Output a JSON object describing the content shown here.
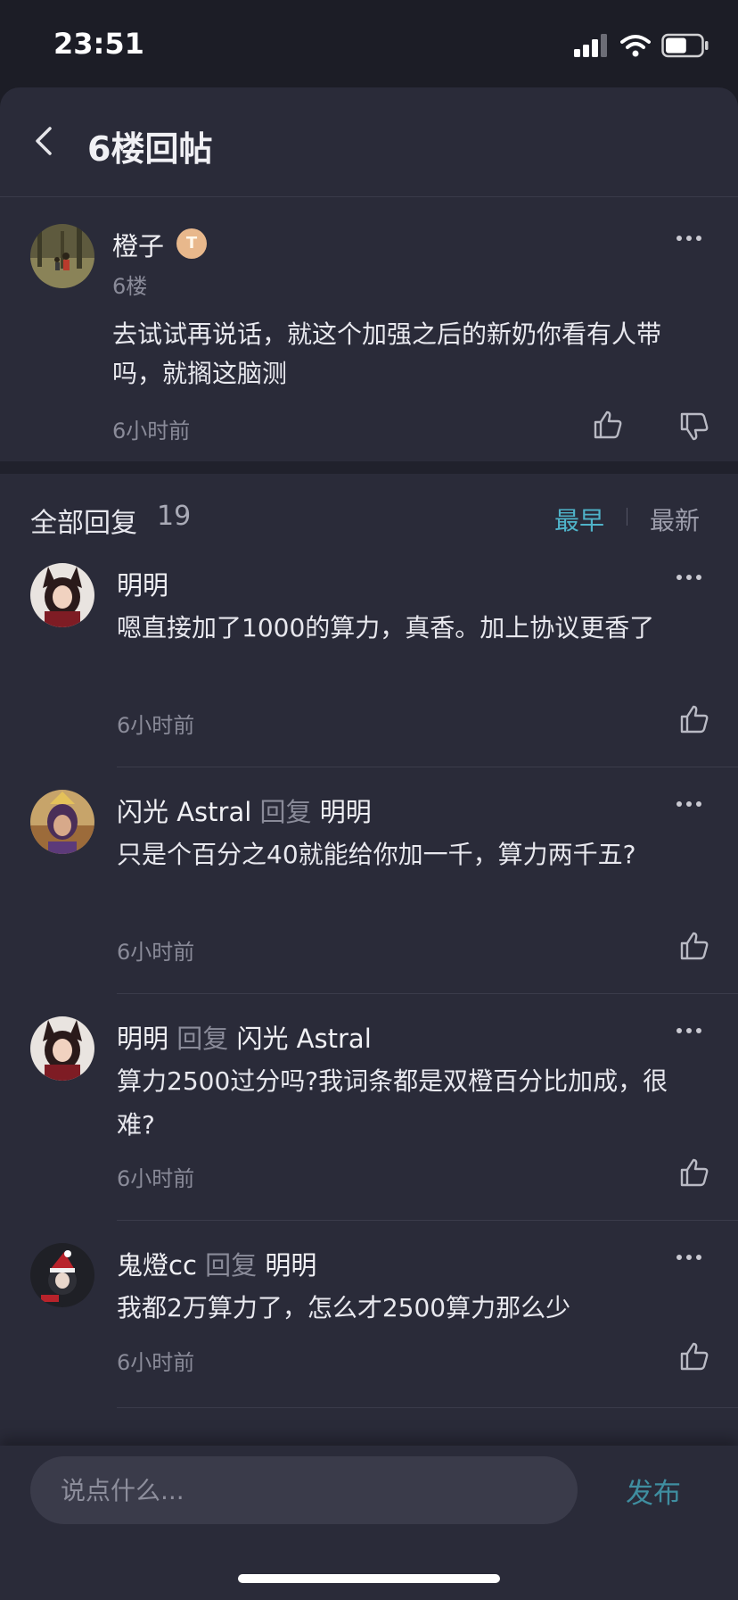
{
  "status_bar": {
    "time": "23:51",
    "battery_level": 0.6
  },
  "nav": {
    "title": "6楼回帖",
    "back_icon": "chevron-left-icon"
  },
  "main_post": {
    "author": "橙子",
    "badge": "T",
    "floor": "6楼",
    "content": "去试试再说话，就这个加强之后的新奶你看有人带吗，就搁这脑测",
    "time": "6小时前"
  },
  "replies_header": {
    "label": "全部回复",
    "count": "19",
    "sort_earliest": "最早",
    "sort_newest": "最新",
    "active_sort": "最早"
  },
  "replies": [
    {
      "author": "明明",
      "verb": "",
      "target": "",
      "content": "嗯直接加了1000的算力，真香。加上协议更香了",
      "time": "6小时前"
    },
    {
      "author": "闪光 Astral",
      "verb": "回复",
      "target": "明明",
      "content": "只是个百分之40就能给你加一千，算力两千五?",
      "time": "6小时前"
    },
    {
      "author": "明明",
      "verb": "回复",
      "target": "闪光 Astral",
      "content": "算力2500过分吗?我词条都是双橙百分比加成，很难?",
      "time": "6小时前"
    },
    {
      "author": "鬼燈cc",
      "verb": "回复",
      "target": "明明",
      "content": "我都2万算力了，怎么才2500算力那么少",
      "time": "6小时前"
    }
  ],
  "input": {
    "placeholder": "说点什么...",
    "publish_label": "发布"
  },
  "colors": {
    "background": "#2a2b39",
    "accent": "#4fb3c9",
    "publish": "#3f8ea0",
    "muted": "#8a8b99"
  }
}
